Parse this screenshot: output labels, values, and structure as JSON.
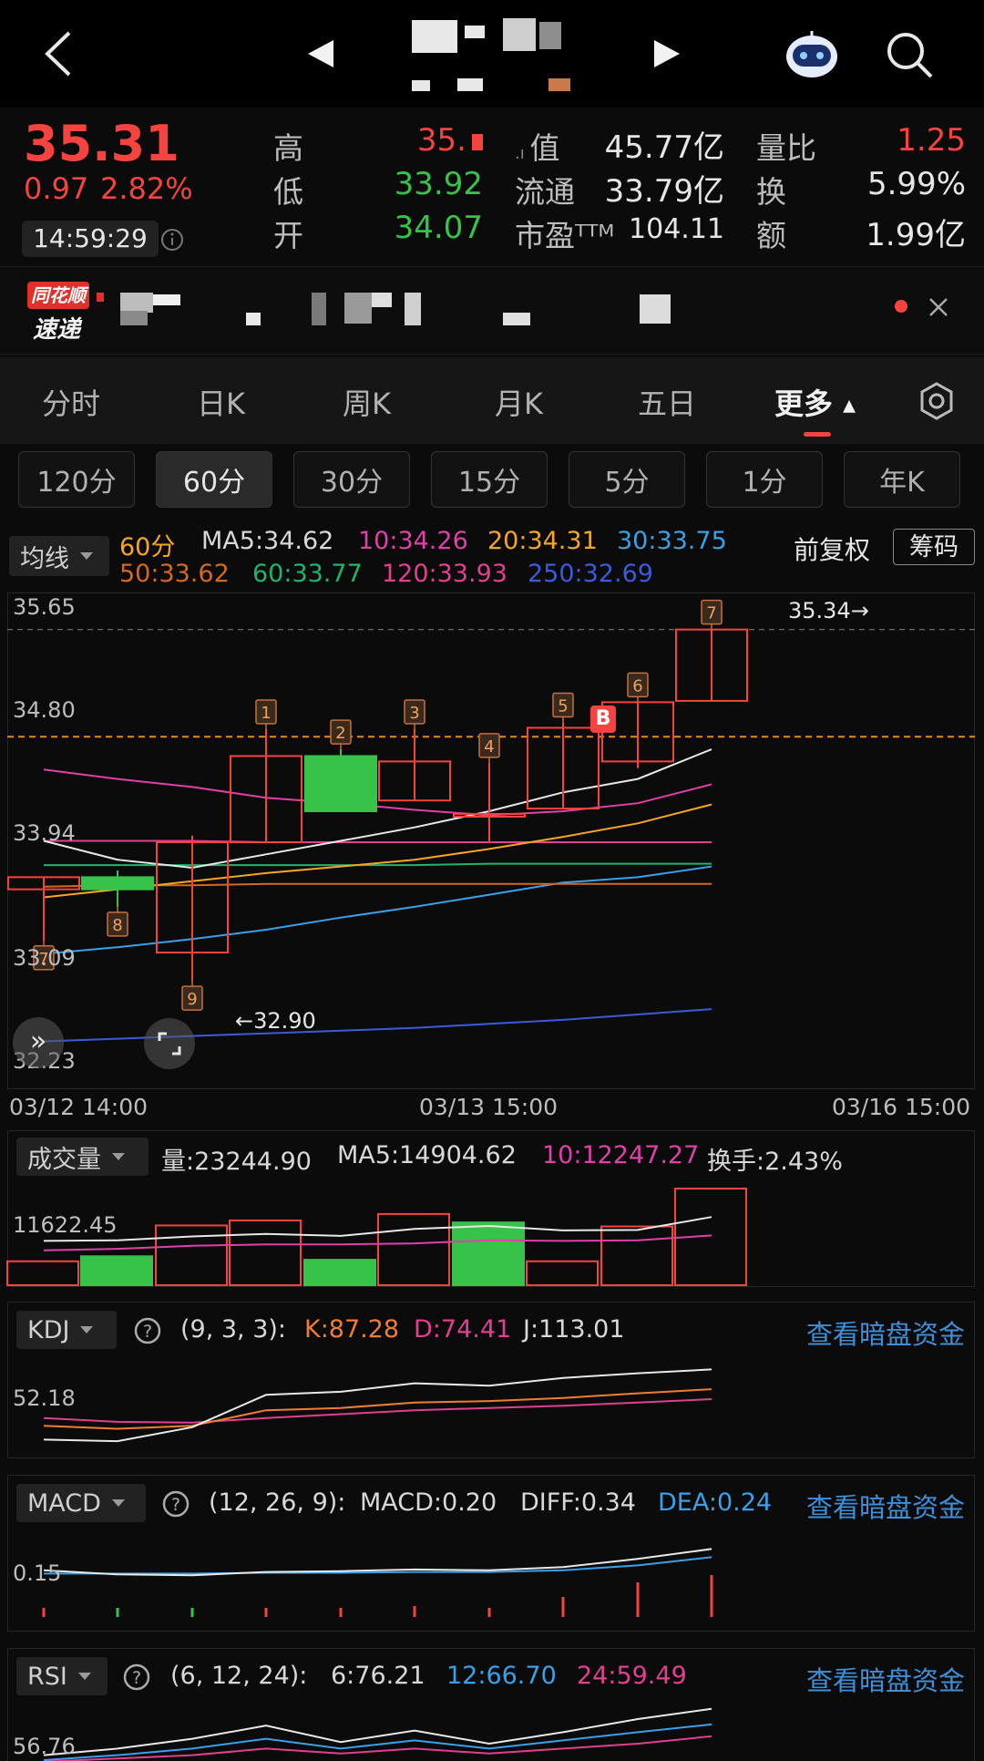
{
  "nav": {
    "back_icon": "chevron-left-icon",
    "prev_icon": "triangle-left-icon",
    "next_icon": "triangle-right-icon",
    "robot_icon": "robot-assistant-icon",
    "search_icon": "search-icon"
  },
  "quote": {
    "price": "35.31",
    "change": "0.97",
    "change_pct": "2.82%",
    "time": "14:59:29",
    "high_label": "高",
    "high_value": "35.",
    "low_label": "低",
    "low_value": "33.92",
    "open_label": "开",
    "open_value": "34.07",
    "mktcap_label": "值",
    "mktcap_value": "45.77亿",
    "float_label": "流通",
    "float_value": "33.79亿",
    "pe_label": "市盈ᵀᵀᴹ",
    "pe_value": "104.11",
    "volratio_label": "量比",
    "volratio_value": "1.25",
    "turnover_label": "换",
    "turnover_value": "5.99%",
    "amount_label": "额",
    "amount_value": "1.99亿"
  },
  "news": {
    "brand_top": "同花顺",
    "brand_bottom": "速递"
  },
  "tabs": [
    "分时",
    "日K",
    "周K",
    "月K",
    "五日",
    "更多"
  ],
  "periods": [
    "120分",
    "60分",
    "30分",
    "15分",
    "5分",
    "1分",
    "年K"
  ],
  "ma_bar": {
    "dropdown": "均线",
    "period": "60分",
    "ma5": "MA5:34.62",
    "ma10": "10:34.26",
    "ma20": "20:34.31",
    "ma30": "30:33.75",
    "ma50": "50:33.62",
    "ma60": "60:33.77",
    "ma120": "120:33.93",
    "ma250": "250:32.69",
    "adjust": "前复权",
    "chips": "筹码"
  },
  "colors": {
    "up": "#f5433f",
    "down": "#37c24a",
    "ma5": "#e8e8e8",
    "ma10": "#e040a8",
    "ma20": "#f5a623",
    "ma30": "#3aa0e8",
    "ma50": "#d2691e",
    "ma60": "#1fb36b",
    "ma120": "#e0408f",
    "ma250": "#3b5bdb"
  },
  "chart": {
    "y_labels": [
      "35.65",
      "34.80",
      "33.94",
      "33.09",
      "32.23"
    ],
    "x_labels": [
      "03/12 14:00",
      "03/13 15:00",
      "03/16 15:00"
    ],
    "high_note": "35.34→",
    "low_note": "←32.90",
    "buy_marker": "B",
    "bar_numbers": [
      "7",
      "8",
      "9",
      "1",
      "2",
      "3",
      "4",
      "5",
      "6",
      "7"
    ]
  },
  "chart_data": {
    "type": "candlestick",
    "ylim": [
      32.23,
      35.65
    ],
    "candles": [
      {
        "open": 33.58,
        "close": 33.67,
        "high": 33.67,
        "low": 33.2
      },
      {
        "open": 33.67,
        "close": 33.58,
        "high": 33.72,
        "low": 33.45
      },
      {
        "open": 33.11,
        "close": 33.93,
        "high": 33.98,
        "low": 32.9
      },
      {
        "open": 33.93,
        "close": 34.57,
        "high": 34.77,
        "low": 33.93
      },
      {
        "open": 34.57,
        "close": 34.16,
        "high": 34.62,
        "low": 34.16
      },
      {
        "open": 34.24,
        "close": 34.53,
        "high": 34.77,
        "low": 34.24
      },
      {
        "open": 34.14,
        "close": 34.14,
        "high": 34.52,
        "low": 33.93
      },
      {
        "open": 34.18,
        "close": 34.78,
        "high": 34.82,
        "low": 34.18
      },
      {
        "open": 34.53,
        "close": 34.97,
        "high": 34.97,
        "low": 34.48
      },
      {
        "open": 34.98,
        "close": 35.51,
        "high": 35.51,
        "low": 34.98
      }
    ],
    "ma": {
      "ma5": [
        33.94,
        33.8,
        33.74,
        33.84,
        33.94,
        34.04,
        34.16,
        34.3,
        34.4,
        34.62
      ],
      "ma10": [
        34.47,
        34.4,
        34.34,
        34.26,
        34.22,
        34.17,
        34.13,
        34.16,
        34.22,
        34.36
      ],
      "ma20": [
        33.52,
        33.58,
        33.64,
        33.7,
        33.75,
        33.8,
        33.88,
        33.97,
        34.07,
        34.21
      ],
      "ma30": [
        33.1,
        33.15,
        33.21,
        33.28,
        33.37,
        33.45,
        33.54,
        33.63,
        33.67,
        33.75
      ],
      "ma50": [
        33.6,
        33.61,
        33.61,
        33.62,
        33.62,
        33.62,
        33.62,
        33.62,
        33.62,
        33.62
      ],
      "ma60": [
        33.76,
        33.76,
        33.76,
        33.76,
        33.76,
        33.76,
        33.77,
        33.77,
        33.77,
        33.77
      ],
      "ma120": [
        33.94,
        33.94,
        33.94,
        33.93,
        33.93,
        33.93,
        33.93,
        33.93,
        33.93,
        33.93
      ],
      "ma250": [
        32.45,
        32.47,
        32.49,
        32.51,
        32.53,
        32.55,
        32.58,
        32.61,
        32.65,
        32.69
      ]
    }
  },
  "volume": {
    "dropdown": "成交量",
    "vol": "量:23244.90",
    "ma5": "MA5:14904.62",
    "ma10": "10:12247.27",
    "turnover": "换手:2.43%",
    "y_label": "11622.45",
    "bars": [
      4800,
      5800,
      12000,
      13000,
      5100,
      14300,
      12600,
      4800,
      11800,
      19400
    ],
    "bar_up": [
      true,
      false,
      true,
      true,
      false,
      true,
      false,
      true,
      true,
      true
    ]
  },
  "kdj": {
    "dropdown": "KDJ",
    "params": "(9, 3, 3):",
    "k": "K:87.28",
    "d": "D:74.41",
    "j": "J:113.01",
    "link": "查看暗盘资金",
    "y_label": "52.18"
  },
  "macd": {
    "dropdown": "MACD",
    "params": "(12, 26, 9):",
    "macd": "MACD:0.20",
    "diff": "DIFF:0.34",
    "dea": "DEA:0.24",
    "link": "查看暗盘资金",
    "y_label": "0.15"
  },
  "rsi": {
    "dropdown": "RSI",
    "params": "(6, 12, 24):",
    "r6": "6:76.21",
    "r12": "12:66.70",
    "r24": "24:59.49",
    "link": "查看暗盘资金",
    "y_label": "56.76"
  }
}
